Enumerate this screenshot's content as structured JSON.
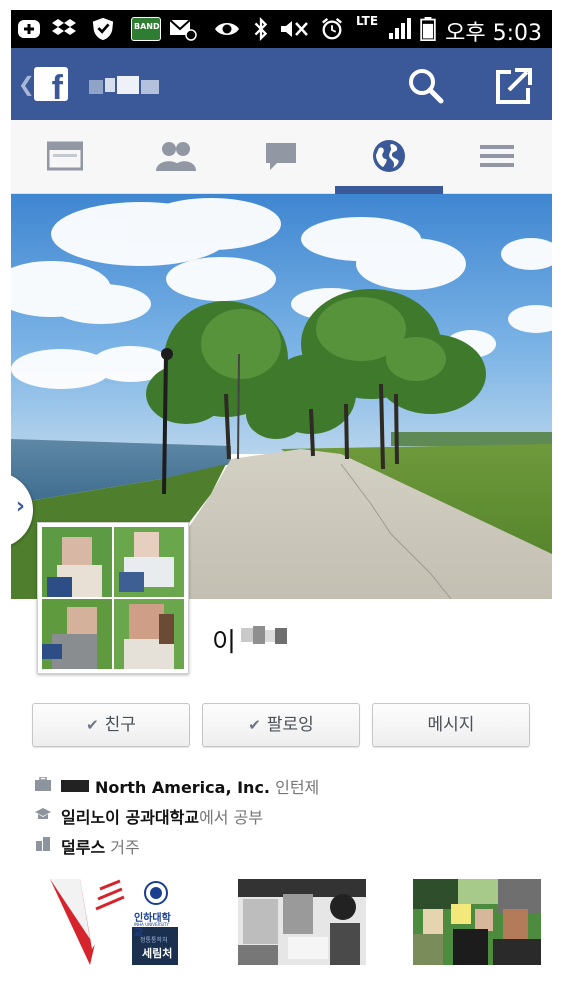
{
  "status_bar": {
    "time": "오후 5:03",
    "network": "LTE",
    "app_label_band": "BAND",
    "icons": [
      "add-icon",
      "dropbox-icon",
      "shield-icon",
      "band-app-icon",
      "mail-icon",
      "eye-icon",
      "bluetooth-icon",
      "mute-icon",
      "alarm-icon",
      "signal-icon",
      "battery-icon"
    ]
  },
  "app_bar": {
    "logo": "f",
    "icons": [
      "back-chevron-icon",
      "search-icon",
      "share-icon"
    ]
  },
  "tabs": [
    {
      "name": "news-feed",
      "icon": "newsfeed-icon",
      "active": false
    },
    {
      "name": "friends",
      "icon": "friends-icon",
      "active": false
    },
    {
      "name": "messages",
      "icon": "chat-icon",
      "active": false
    },
    {
      "name": "notifications",
      "icon": "globe-icon",
      "active": true
    },
    {
      "name": "menu",
      "icon": "hamburger-icon",
      "active": false
    }
  ],
  "profile": {
    "name_visible": "이"
  },
  "actions": {
    "friend": "친구",
    "follow": "팔로잉",
    "message": "메시지"
  },
  "info": {
    "work_company": "North America, Inc.",
    "work_suffix": "인턴제",
    "school": "일리노이 공과대학교",
    "school_suffix": "에서 공부",
    "city": "덜루스",
    "city_suffix": "거주"
  },
  "thumbnails": {
    "school_name": "인하대학교",
    "school_sub": "INHA UNIVERSITY",
    "caption_top": "정통통학처",
    "caption_bottom": "세림처"
  },
  "colors": {
    "brand": "#3b5998",
    "status_bar": "#000000",
    "tab_bar": "#f7f7f7"
  }
}
